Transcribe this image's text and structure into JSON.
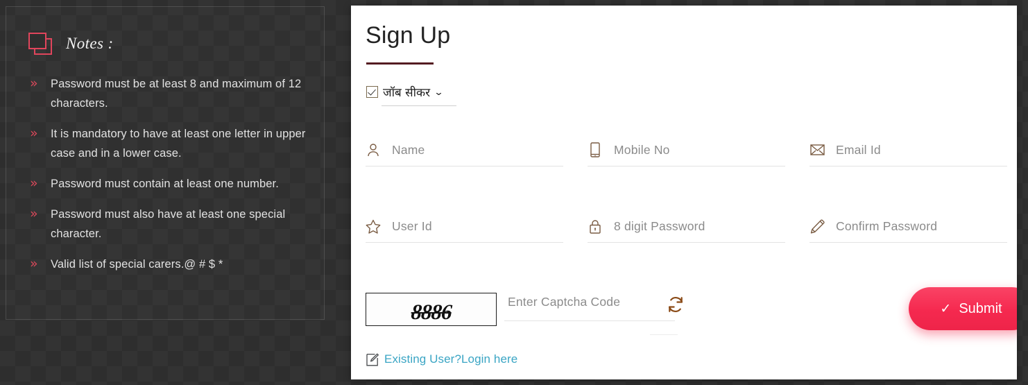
{
  "notes_panel": {
    "icon": "copy-layers-icon",
    "title": "Notes :",
    "bullet_glyph": "»",
    "items": [
      "Password must be at least 8 and maximum of 12 characters.",
      "It is mandatory to have at least one letter in upper case and in a lower case.",
      "Password must contain at least one number.",
      "Password must also have at least one special character.",
      "Valid list of special carers.@ # $ *"
    ]
  },
  "signup": {
    "title": "Sign Up",
    "role": {
      "icon": "checkbox-checked-icon",
      "label": "जॉब सीकर",
      "caret": "⌄"
    },
    "fields": [
      {
        "icon": "user-icon",
        "placeholder": "Name"
      },
      {
        "icon": "mobile-icon",
        "placeholder": "Mobile No"
      },
      {
        "icon": "envelope-icon",
        "placeholder": "Email Id"
      },
      {
        "icon": "star-icon",
        "placeholder": "User Id"
      },
      {
        "icon": "lock-icon",
        "placeholder": "8 digit Password"
      },
      {
        "icon": "pencil-icon",
        "placeholder": "Confirm Password"
      }
    ],
    "captcha": {
      "code": "8886",
      "placeholder": "Enter Captcha Code",
      "refresh_icon": "refresh-icon"
    },
    "submit": {
      "label": "Submit",
      "check_glyph": "✓"
    },
    "login_link": {
      "icon": "edit-note-icon",
      "text": "Existing User?Login here"
    }
  },
  "colors": {
    "accent_red": "#e0455c",
    "submit_pink": "#f5294f",
    "title_rule": "#541c22",
    "icon_brown": "#7a5c43",
    "link_teal": "#3aa5c4",
    "panel_bg": "#2e2e2e"
  }
}
